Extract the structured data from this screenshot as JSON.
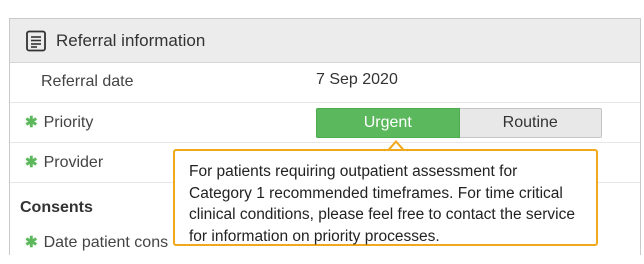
{
  "panel": {
    "title": "Referral information",
    "icon": "document-icon"
  },
  "rows": {
    "referral_date": {
      "label": "Referral date",
      "value": "7 Sep 2020"
    },
    "priority": {
      "required_mark": "✱",
      "label": "Priority",
      "options": [
        "Urgent",
        "Routine"
      ],
      "selected": "Urgent"
    },
    "provider": {
      "required_mark": "✱",
      "label": "Provider"
    },
    "date_consent": {
      "required_mark": "✱",
      "label": "Date patient cons"
    }
  },
  "consents": {
    "heading": "Consents"
  },
  "tooltip": {
    "text": "For patients requiring outpatient assessment for Category 1 recommended timeframes. For time critical clinical conditions, please feel free to contact the service for information on priority processes."
  },
  "colors": {
    "accent_green": "#5cb85c",
    "tooltip_border": "#f0a81c",
    "header_bg": "#ececec"
  }
}
